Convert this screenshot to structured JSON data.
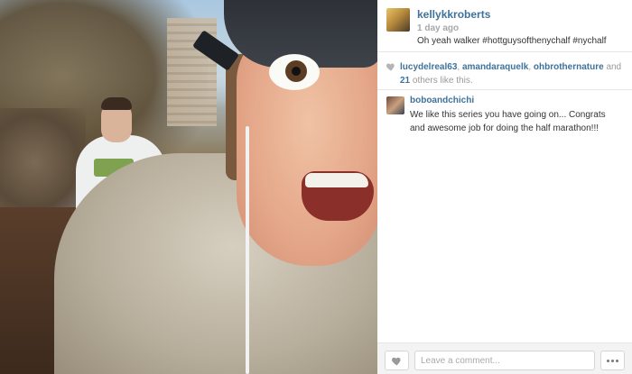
{
  "post": {
    "owner_username": "kellykkroberts",
    "time_ago": "1 day ago",
    "caption": "Oh yeah walker #hottguysofthenychalf #nychalf"
  },
  "likes": {
    "user_1": "lucydelreal63",
    "user_2": "amandaraquelk",
    "user_3": "ohbrothernature",
    "connector": "and",
    "others_count": "21",
    "suffix": "others like this."
  },
  "comments": [
    {
      "username": "boboandchichi",
      "text": "We like this series you have going on... Congrats and awesome job for doing the half marathon!!!"
    }
  ],
  "footer": {
    "comment_placeholder": "Leave a comment..."
  },
  "icons": {
    "like_small": "heart-icon",
    "like_button": "heart-icon",
    "more_button": "more-options-icon"
  },
  "colors": {
    "username_blue": "#3f729b",
    "meta_gray": "#a5a7aa"
  }
}
